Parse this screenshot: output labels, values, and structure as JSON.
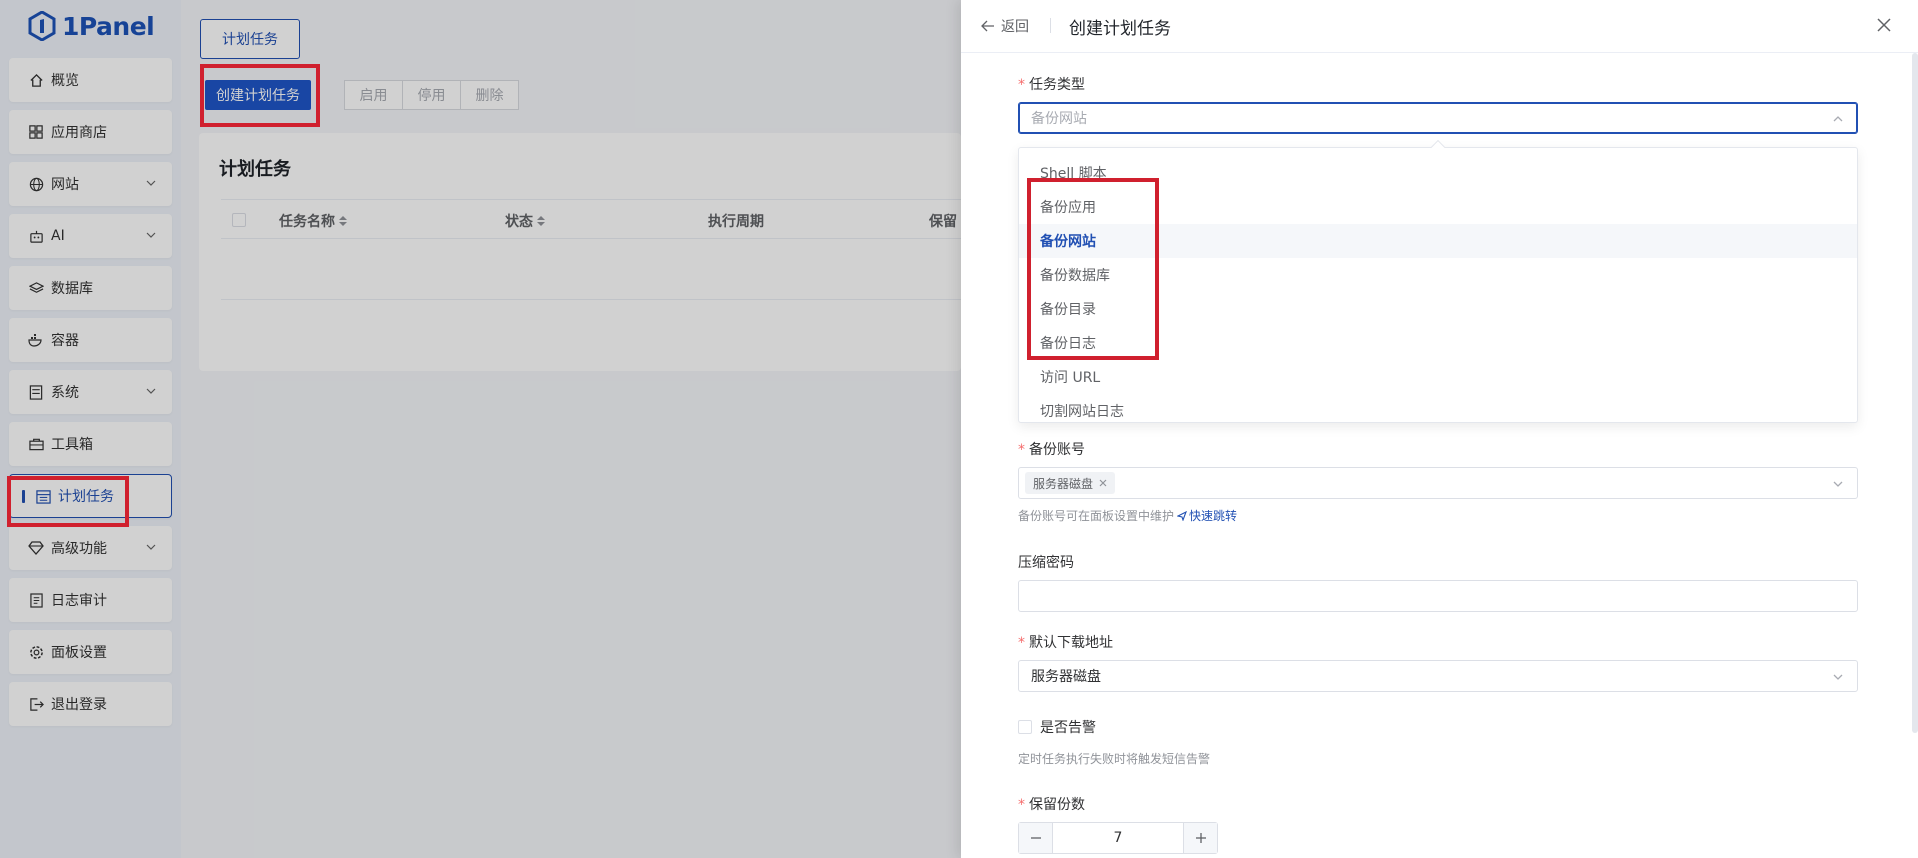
{
  "app": {
    "logo_text": "1Panel"
  },
  "sidebar": {
    "items": [
      {
        "label": "概览",
        "icon": "home-icon"
      },
      {
        "label": "应用商店",
        "icon": "grid-icon"
      },
      {
        "label": "网站",
        "icon": "globe-icon",
        "has_children": true
      },
      {
        "label": "AI",
        "icon": "robot-icon",
        "has_children": true
      },
      {
        "label": "数据库",
        "icon": "layers-icon"
      },
      {
        "label": "容器",
        "icon": "docker-icon"
      },
      {
        "label": "系统",
        "icon": "server-icon",
        "has_children": true
      },
      {
        "label": "工具箱",
        "icon": "toolbox-icon"
      },
      {
        "label": "计划任务",
        "icon": "calendar-icon",
        "active": true
      },
      {
        "label": "高级功能",
        "icon": "diamond-icon",
        "has_children": true
      },
      {
        "label": "日志审计",
        "icon": "document-icon"
      },
      {
        "label": "面板设置",
        "icon": "gear-icon"
      },
      {
        "label": "退出登录",
        "icon": "logout-icon"
      }
    ]
  },
  "main": {
    "tab_label": "计划任务",
    "create_button": "创建计划任务",
    "actions": [
      "启用",
      "停用",
      "删除"
    ],
    "card_title": "计划任务",
    "columns": [
      "任务名称",
      "状态",
      "执行周期",
      "保留"
    ]
  },
  "drawer": {
    "back_label": "返回",
    "title": "创建计划任务",
    "task_type": {
      "label": "任务类型",
      "placeholder": "备份网站",
      "options": [
        "Shell 脚本",
        "备份应用",
        "备份网站",
        "备份数据库",
        "备份目录",
        "备份日志",
        "访问 URL",
        "切割网站日志"
      ],
      "selected_index": 2
    },
    "backup_account": {
      "label": "备份账号",
      "tag": "服务器磁盘",
      "hint": "备份账号可在面板设置中维护",
      "hint_link": "快速跳转"
    },
    "zip_password": {
      "label": "压缩密码",
      "value": ""
    },
    "default_download": {
      "label": "默认下载地址",
      "value": "服务器磁盘"
    },
    "alert": {
      "label": "是否告警",
      "hint": "定时任务执行失败时将触发短信告警"
    },
    "retain": {
      "label": "保留份数",
      "value": "7"
    }
  },
  "colors": {
    "accent": "#2150b3",
    "annotation": "#d0202e"
  }
}
